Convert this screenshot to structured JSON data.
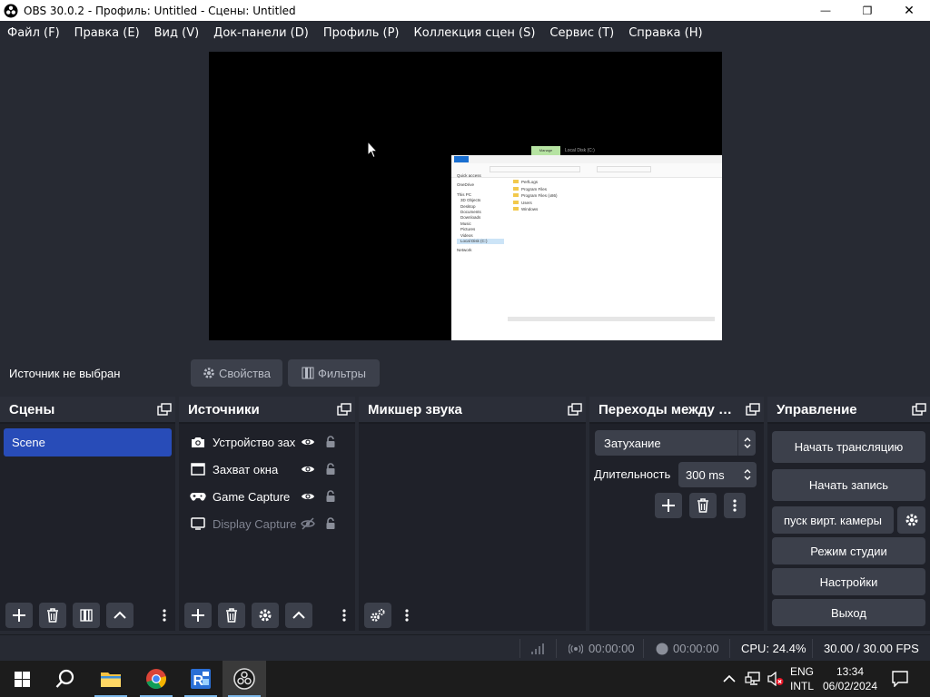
{
  "window": {
    "title": "OBS 30.0.2 - Профиль: Untitled - Сцены: Untitled",
    "minimize_glyph": "—",
    "maximize_glyph": "❐",
    "close_glyph": "✕"
  },
  "menu": [
    "Файл (F)",
    "Правка (E)",
    "Вид (V)",
    "Док-панели (D)",
    "Профиль (P)",
    "Коллекция сцен (S)",
    "Сервис (T)",
    "Справка (H)"
  ],
  "source_toolbar": {
    "status": "Источник не выбран",
    "properties_label": "Свойства",
    "filters_label": "Фильтры"
  },
  "docks": {
    "scenes": {
      "title": "Сцены",
      "items": [
        "Scene"
      ]
    },
    "sources": {
      "title": "Источники",
      "items": [
        {
          "name": "Устройство захвата видео",
          "icon": "camera-icon",
          "visible": true,
          "enabled": true
        },
        {
          "name": "Захват окна",
          "icon": "window-icon",
          "visible": true,
          "enabled": true
        },
        {
          "name": "Game Capture",
          "icon": "gamepad-icon",
          "visible": true,
          "enabled": true
        },
        {
          "name": "Display Capture",
          "icon": "monitor-icon",
          "visible": false,
          "enabled": false
        }
      ]
    },
    "mixer": {
      "title": "Микшер звука"
    },
    "transitions": {
      "title": "Переходы между сценами",
      "selected": "Затухание",
      "duration_label": "Длительность",
      "duration_value": "300 ms"
    },
    "controls": {
      "title": "Управление",
      "buttons": [
        "Начать трансляцию",
        "Начать запись",
        "пуск вирт. камеры",
        "Режим студии",
        "Настройки",
        "Выход"
      ]
    }
  },
  "statusbar": {
    "stream_time": "00:00:00",
    "record_time": "00:00:00",
    "cpu": "CPU: 24.4%",
    "fps": "30.00 / 30.00 FPS"
  },
  "taskbar": {
    "lang_top": "ENG",
    "lang_bottom": "INTL",
    "time": "13:34",
    "date": "06/02/2024",
    "apps": [
      "start",
      "search",
      "file-explorer",
      "chrome",
      "remote-app",
      "obs"
    ]
  },
  "captured_window": {
    "tab_label": "Manage",
    "title": "Local Disk (C:)",
    "nav_items": [
      "Quick access",
      "OneDrive",
      "This PC",
      "3D Objects",
      "Desktop",
      "Documents",
      "Downloads",
      "Music",
      "Pictures",
      "Videos",
      "Local Disk (C:)",
      "Network"
    ],
    "folders": [
      "PerfLogs",
      "Program Files",
      "Program Files (x86)",
      "Users",
      "Windows"
    ]
  },
  "colors": {
    "accent": "#284cb8",
    "dock_bg": "#1f2129",
    "panel_bg": "#272a33",
    "button_bg": "#3c404b"
  }
}
